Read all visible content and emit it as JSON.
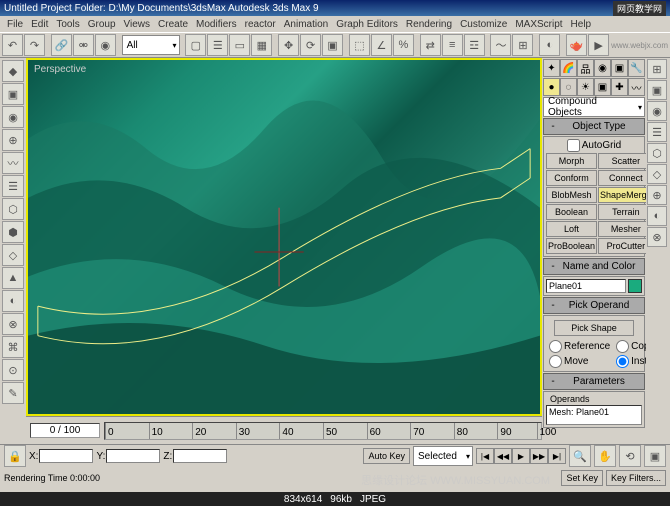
{
  "title": "Untitled    Project Folder: D:\\My Documents\\3dsMax    Autodesk 3ds Max 9",
  "watermark_top": "网页教学网",
  "watermark_url": "www.webjx.com",
  "watermark_bottom": "思缘设计论坛 WWW.MISSYUAN.COM",
  "menu": [
    "File",
    "Edit",
    "Tools",
    "Group",
    "Views",
    "Create",
    "Modifiers",
    "reactor",
    "Animation",
    "Graph Editors",
    "Rendering",
    "Customize",
    "MAXScript",
    "Help"
  ],
  "toolbar_dropdown": "All",
  "viewport_label": "Perspective",
  "timeline": {
    "current": "0 / 100",
    "ticks": [
      0,
      10,
      20,
      30,
      40,
      50,
      60,
      70,
      80,
      90,
      100
    ]
  },
  "right": {
    "category": "Compound Objects",
    "object_type": {
      "title": "Object Type",
      "autogrid": "AutoGrid",
      "buttons": [
        "Morph",
        "Scatter",
        "Conform",
        "Connect",
        "BlobMesh",
        "ShapeMerge",
        "Boolean",
        "Terrain",
        "Loft",
        "Mesher",
        "ProBoolean",
        "ProCutter"
      ],
      "active": "ShapeMerge"
    },
    "name_color": {
      "title": "Name and Color",
      "name": "Plane01"
    },
    "pick_operand": {
      "title": "Pick Operand",
      "button": "Pick Shape",
      "opts": {
        "reference": "Reference",
        "copy": "Copy",
        "move": "Move",
        "instance": "Instance"
      }
    },
    "parameters": {
      "title": "Parameters",
      "operands_label": "Operands",
      "item": "Mesh: Plane01"
    }
  },
  "bottom": {
    "x": "X:",
    "y": "Y:",
    "z": "Z:",
    "autokey": "Auto Key",
    "setkey": "Set Key",
    "selected": "Selected",
    "keyfilters": "Key Filters...",
    "rendtime": "Rendering Time 0:00:00"
  },
  "footer": {
    "dims": "834x614",
    "size": "96kb",
    "fmt": "JPEG"
  }
}
